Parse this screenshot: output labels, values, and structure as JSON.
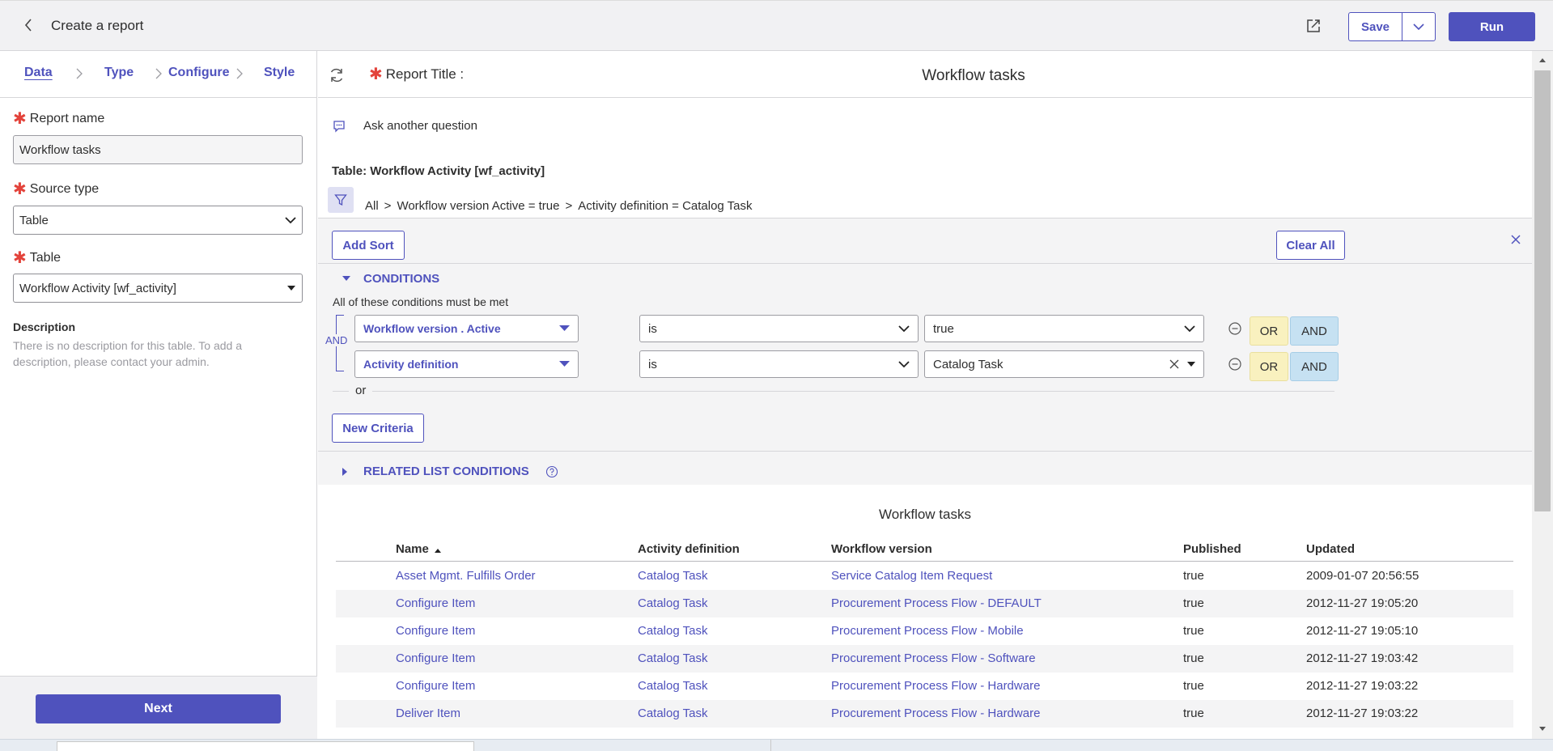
{
  "header": {
    "title": "Create a report",
    "save_label": "Save",
    "run_label": "Run"
  },
  "steps": [
    "Data",
    "Type",
    "Configure",
    "Style"
  ],
  "form": {
    "report_name_label": "Report name",
    "report_name_value": "Workflow tasks",
    "source_type_label": "Source type",
    "source_type_value": "Table",
    "table_label": "Table",
    "table_value": "Workflow Activity [wf_activity]",
    "description_label": "Description",
    "description_text": "There is no description for this table. To add a description, please contact your admin."
  },
  "footer": {
    "next_label": "Next"
  },
  "report": {
    "title_label": "Report Title :",
    "title_value": "Workflow tasks",
    "ask_label": "Ask another question",
    "table_name": "Table: Workflow Activity [wf_activity]",
    "breadcrumb": [
      "All",
      ">",
      "Workflow version Active = true",
      ">",
      "Activity definition = Catalog Task"
    ]
  },
  "conditions": {
    "add_sort": "Add Sort",
    "clear_all": "Clear All",
    "section_title": "CONDITIONS",
    "all_met": "All of these conditions must be met",
    "and_tag": "AND",
    "rows": [
      {
        "field": "Workflow version . Active",
        "operator": "is",
        "value": "true"
      },
      {
        "field": "Activity definition",
        "operator": "is",
        "value": "Catalog Task"
      }
    ],
    "or_label": "OR",
    "and_label": "AND",
    "or_separator": "or",
    "new_criteria": "New Criteria",
    "related_title": "RELATED LIST CONDITIONS"
  },
  "results": {
    "title": "Workflow tasks",
    "columns": [
      "Name",
      "Activity definition",
      "Workflow version",
      "Published",
      "Updated"
    ],
    "rows": [
      [
        "Asset Mgmt. Fulfills Order",
        "Catalog Task",
        "Service Catalog Item Request",
        "true",
        "2009-01-07 20:56:55"
      ],
      [
        "Configure Item",
        "Catalog Task",
        "Procurement Process Flow - DEFAULT",
        "true",
        "2012-11-27 19:05:20"
      ],
      [
        "Configure Item",
        "Catalog Task",
        "Procurement Process Flow - Mobile",
        "true",
        "2012-11-27 19:05:10"
      ],
      [
        "Configure Item",
        "Catalog Task",
        "Procurement Process Flow - Software",
        "true",
        "2012-11-27 19:03:42"
      ],
      [
        "Configure Item",
        "Catalog Task",
        "Procurement Process Flow - Hardware",
        "true",
        "2012-11-27 19:03:22"
      ],
      [
        "Deliver Item",
        "Catalog Task",
        "Procurement Process Flow - Hardware",
        "true",
        "2012-11-27 19:03:22"
      ]
    ]
  },
  "colors": {
    "accent": "#4f52bd",
    "required": "#e3433b",
    "or_button": "#f9f1bf",
    "and_button": "#c6e1f2"
  }
}
